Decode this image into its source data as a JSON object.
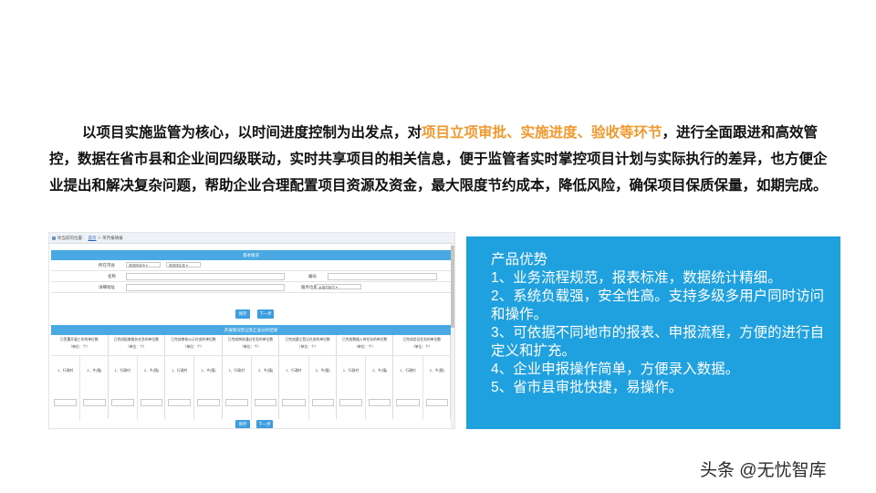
{
  "intro": {
    "part1": "以项目实施监管为核心，以时间进度控制为出发点，对",
    "highlight": "项目立项审批、实施进度、验收等环节",
    "part2": "，进行全面跟进和高效管控，数据在省市县和企业间四级联动，实时共享项目的相关信息，便于监管者实时掌控项目计划与实际执行的差异，也方便企业提出和解决复杂问题，帮助企业合理配置项目资源及资金，最大限度节约成本，降低风险，确保项目保质保量，如期完成。",
    "highlight_color": "#f2992e"
  },
  "screenshot": {
    "breadcrumb": {
      "prefix": "你当前的位置：",
      "home": "首页",
      "sep": " > ",
      "current": "单月报填报"
    },
    "basic_info_header": "基本情况",
    "fields": {
      "region_label": "所在市县",
      "city_select": "请选择地市",
      "county_select": "请选择区县",
      "name_label": "名称",
      "code_label": "编号",
      "address_label": "详细地址",
      "service_label": "服务位置",
      "service_select": "乡镇村街内"
    },
    "buttons": {
      "save": "保存",
      "next": "下一步"
    },
    "section_header": "开展情况登记及汇总分析结果",
    "columns": [
      {
        "title": "已签署开展工作的单位数",
        "unit": "（单位：个）"
      },
      {
        "title": "已完成配套服务任务的单位数",
        "unit": "（单位：个）"
      },
      {
        "title": "已完成审核公示任务的单位数",
        "unit": "（单位：个）"
      },
      {
        "title": "已完成审核通过任务的单位数",
        "unit": "（单位：个）"
      },
      {
        "title": "已完成建立登记任务的单位数",
        "unit": "（单位：个）"
      },
      {
        "title": "已完成数据入库任务的单位数",
        "unit": "（单位：个）"
      },
      {
        "title": "已完成验证任务的单位数",
        "unit": "（单位：个）"
      }
    ],
    "option_a": "1、行政村",
    "option_b": "2、乡(镇)"
  },
  "advantages": {
    "title": "产品优势",
    "items": [
      "1、业务流程规范，报表标准，数据统计精细。",
      "2、系统负载强，安全性高。支持多级多用户同时访问和操作。",
      "3、可依据不同地市的报表、申报流程，方便的进行自定义和扩充。",
      "4、企业申报操作简单，方便录入数据。",
      "5、省市县审批快捷，易操作。"
    ],
    "card_color": "#1fa1e0"
  },
  "watermark": "头条 @无忧智库"
}
